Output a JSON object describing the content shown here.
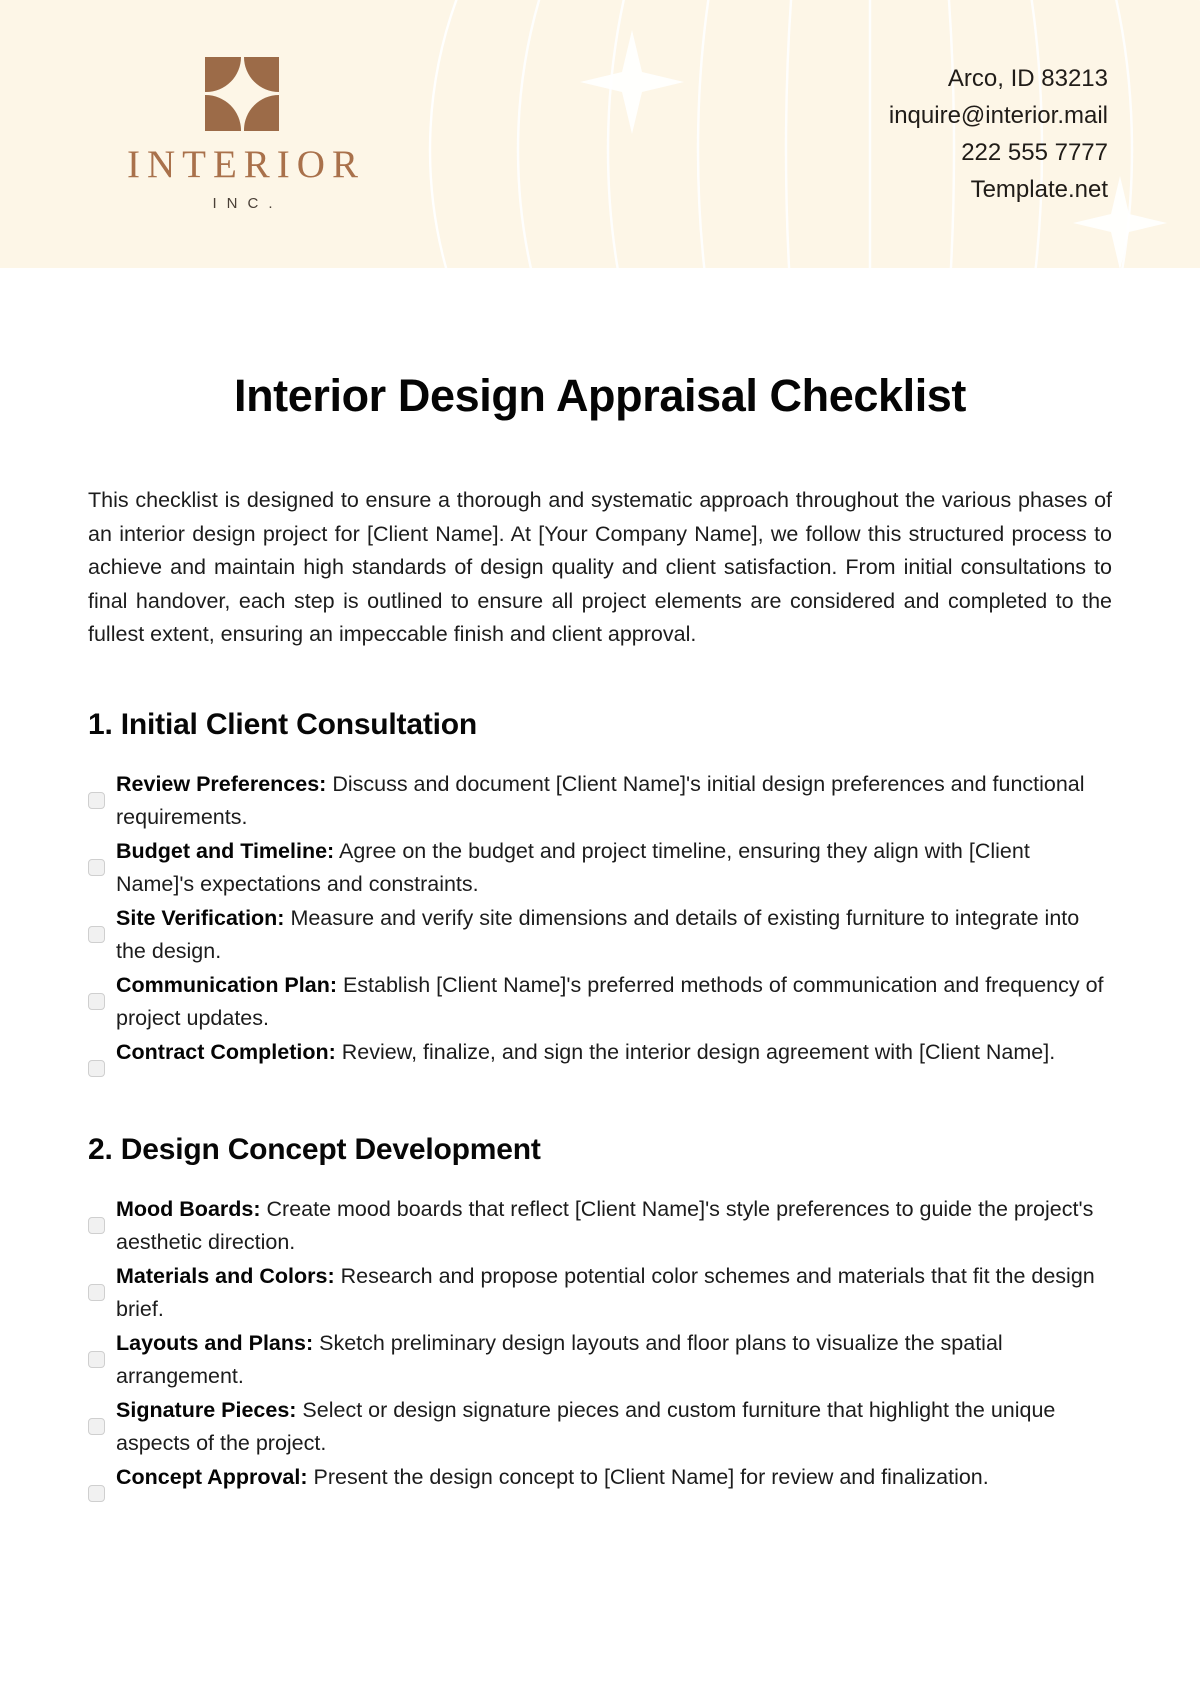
{
  "header": {
    "logo": {
      "mark_color": "#9c6b48",
      "name": "INTERIOR",
      "suffix": "INC."
    },
    "contact": {
      "address": "Arco, ID 83213",
      "email": "inquire@interior.mail",
      "phone": "222 555 7777",
      "website": "Template.net"
    },
    "background_color": "#fdf6e7"
  },
  "document": {
    "title": "Interior Design Appraisal Checklist",
    "intro": "This checklist is designed to ensure a thorough and systematic approach throughout the various phases of an interior design project for [Client Name]. At [Your Company Name], we follow this structured process to achieve and maintain high standards of design quality and client satisfaction. From initial consultations to final handover, each step is outlined to ensure all project elements are considered and completed to the fullest extent, ensuring an impeccable finish and client approval.",
    "sections": [
      {
        "title": "1. Initial Client Consultation",
        "items": [
          {
            "label": "Review Preferences:",
            "text": " Discuss and document [Client Name]'s initial design preferences and functional requirements.",
            "checked": false
          },
          {
            "label": "Budget and Timeline:",
            "text": " Agree on the budget and project timeline, ensuring they align with [Client Name]'s expectations and constraints.",
            "checked": false
          },
          {
            "label": "Site Verification:",
            "text": " Measure and verify site dimensions and details of existing furniture to integrate into the design.",
            "checked": false
          },
          {
            "label": "Communication Plan:",
            "text": " Establish [Client Name]'s preferred methods of communication and frequency of project updates.",
            "checked": false
          },
          {
            "label": "Contract Completion:",
            "text": " Review, finalize, and sign the interior design agreement with [Client Name].",
            "checked": false
          }
        ]
      },
      {
        "title": "2. Design Concept Development",
        "items": [
          {
            "label": "Mood Boards:",
            "text": " Create mood boards that reflect [Client Name]'s style preferences to guide the project's aesthetic direction.",
            "checked": false
          },
          {
            "label": "Materials and Colors:",
            "text": " Research and propose potential color schemes and materials that fit the design brief.",
            "checked": false
          },
          {
            "label": "Layouts and Plans:",
            "text": " Sketch preliminary design layouts and floor plans to visualize the spatial arrangement.",
            "checked": false
          },
          {
            "label": "Signature Pieces:",
            "text": " Select or design signature pieces and custom furniture that highlight the unique aspects of the project.",
            "checked": false
          },
          {
            "label": "Concept Approval:",
            "text": " Present the design concept to [Client Name] for review and finalization.",
            "checked": false
          }
        ]
      }
    ]
  }
}
